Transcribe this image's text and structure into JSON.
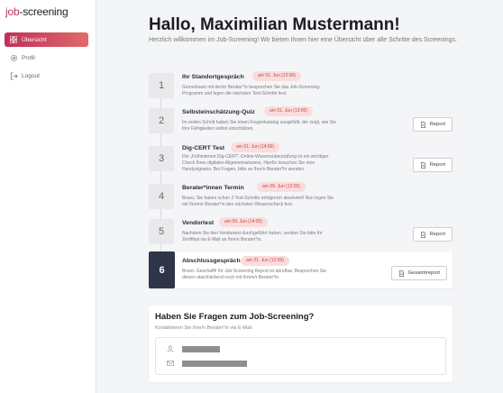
{
  "app": {
    "logo_prefix": "job",
    "logo_suffix": "screening"
  },
  "sidebar": {
    "items": [
      {
        "label": "Übersicht",
        "icon": "grid-icon",
        "active": true
      },
      {
        "label": "Profil",
        "icon": "gear-icon",
        "active": false
      },
      {
        "label": "Logout",
        "icon": "logout-icon",
        "active": false
      }
    ]
  },
  "header": {
    "title": "Hallo, Maximilian Mustermann!",
    "subtitle": "Herzlich willkommen im Job-Screening! Wir bieten Ihnen hier eine Übersicht über alle Schritte des Screenings."
  },
  "steps": [
    {
      "number": "1",
      "title": "Ihr Standortgespräch",
      "date": "am 01. Jun (12:00)",
      "desc": "Gemeinsam mit der/m Berater*in besprechen Sie das Job-Screening-Programm und legen die nächsten Test-Schritte fest.",
      "button": ""
    },
    {
      "number": "2",
      "title": "Selbsteinschätzung-Quiz",
      "date": "am 01. Jun (13:00)",
      "desc": "Im ersten Schritt haben Sie einen Fragenkatalog ausgefüllt, der zeigt, wie Sie Ihre Fähigkeiten selbst einschätzen.",
      "button": "Report"
    },
    {
      "number": "3",
      "title": "Dig-CERT Test",
      "date": "am 01. Jun (14:00)",
      "desc": "Die „Frühinternet Dig-CERT“-Online-Wissensüberprüfung ist ein wichtiger Check Ihres digitalen Allgemeinwissens. Hierfür brauchen Sie eine Handysignatur. Bei Fragen, bitte an Ihre/n Berater*in wenden.",
      "button": "Report"
    },
    {
      "number": "4",
      "title": "Berater*innen Termin",
      "date": "am 09. Jun (12:00)",
      "desc": "Bravo, Sie haben schon 2 Test-Schritte erfolgreich absolviert! Nun legen Sie mit Ihrem/r Berater*in den nächsten Wissenscheck fest.",
      "button": ""
    },
    {
      "number": "5",
      "title": "Vendortest",
      "date": "am 09. Jun (14:00)",
      "desc": "Nachdem Sie den Vendortest durchgeführt haben, senden Sie bitte Ihr Zertifikat via E-Mail an Ihre/n Berater*in.",
      "button": "Report"
    },
    {
      "number": "6",
      "title": "Abschlussgespräch",
      "date": "am 21. Jun (12:00)",
      "desc": "Bravo. Geschafft! Ihr Job-Screening Report ist abrufbar. Besprechen Sie diesen abschließend noch mit Ihrem/r Berater*in.",
      "button": "Gesamtreport"
    }
  ],
  "contact": {
    "title": "Haben Sie Fragen zum Job-Screening?",
    "subtitle": "Kontaktieren Sie Ihre/n Berater*in via E-Mail"
  },
  "colors": {
    "accent": "#c0305a",
    "badge_bg": "#fbdcdc",
    "active_step": "#2f3548"
  }
}
